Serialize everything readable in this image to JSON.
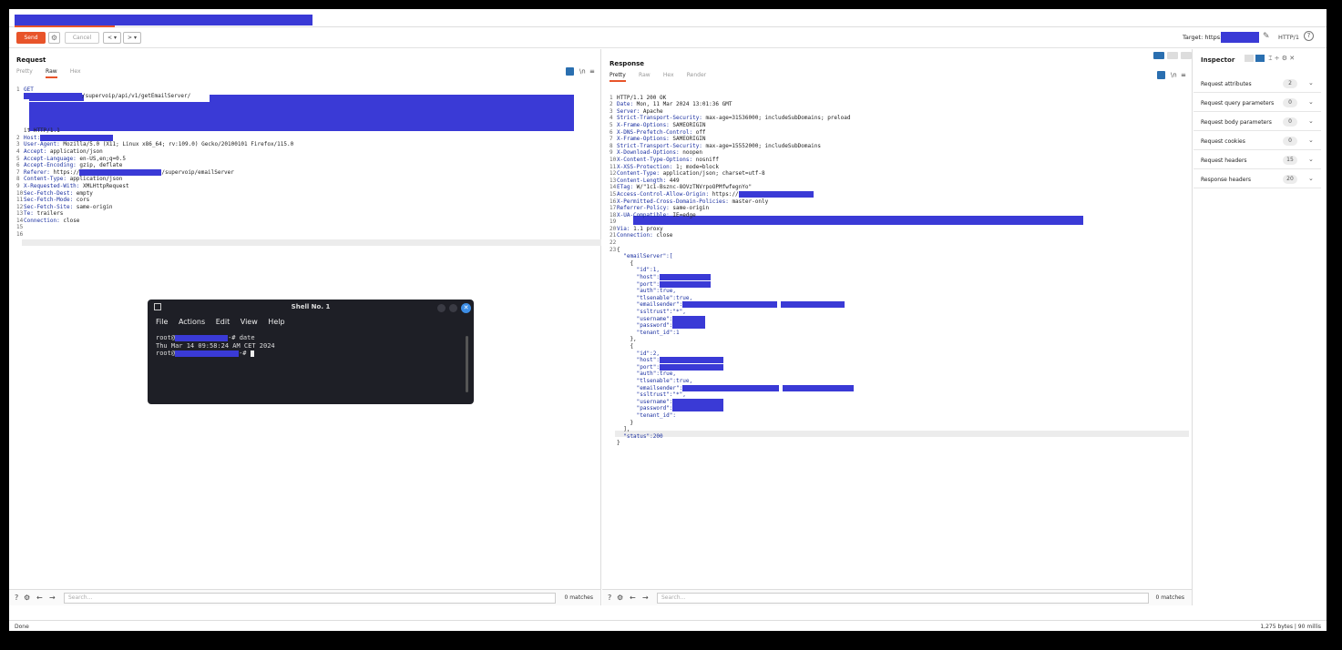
{
  "toolbar": {
    "send_label": "Send",
    "cancel_label": "Cancel",
    "back_label": "< ▾",
    "forward_label": "> ▾",
    "target_label": "Target: https://",
    "protocol_label": "HTTP/1"
  },
  "request": {
    "title": "Request",
    "tabs": [
      "Pretty",
      "Raw",
      "Hex"
    ],
    "active_tab": "Raw",
    "lines": [
      {
        "n": "1",
        "k": "GET",
        "v": ""
      },
      {
        "n": "",
        "k": "",
        "v": "/supervoip/api/v1/getEmailServer/"
      },
      {
        "n": "",
        "k": "",
        "v": "it HTTP/1.1"
      },
      {
        "n": "2",
        "k": "Host:",
        "v": ""
      },
      {
        "n": "3",
        "k": "User-Agent:",
        "v": " Mozilla/5.0 (X11; Linux x86_64; rv:109.0) Gecko/20100101 Firefox/115.0"
      },
      {
        "n": "4",
        "k": "Accept:",
        "v": " application/json"
      },
      {
        "n": "5",
        "k": "Accept-Language:",
        "v": " en-US,en;q=0.5"
      },
      {
        "n": "6",
        "k": "Accept-Encoding:",
        "v": " gzip, deflate"
      },
      {
        "n": "7",
        "k": "Referer:",
        "v": " https://"
      },
      {
        "n": "8",
        "k": "Content-Type:",
        "v": " application/json"
      },
      {
        "n": "9",
        "k": "X-Requested-With:",
        "v": " XMLHttpRequest"
      },
      {
        "n": "10",
        "k": "Sec-Fetch-Dest:",
        "v": " empty"
      },
      {
        "n": "11",
        "k": "Sec-Fetch-Mode:",
        "v": " cors"
      },
      {
        "n": "12",
        "k": "Sec-Fetch-Site:",
        "v": " same-origin"
      },
      {
        "n": "13",
        "k": "Te:",
        "v": " trailers"
      },
      {
        "n": "14",
        "k": "Connection:",
        "v": " close"
      },
      {
        "n": "15",
        "k": "",
        "v": ""
      },
      {
        "n": "16",
        "k": "",
        "v": ""
      }
    ],
    "referer_suffix": "/supervoip/emailServer",
    "search_placeholder": "Search...",
    "matches": "0 matches"
  },
  "response": {
    "title": "Response",
    "tabs": [
      "Pretty",
      "Raw",
      "Hex",
      "Render"
    ],
    "active_tab": "Pretty",
    "lines": [
      {
        "n": "1",
        "k": "HTTP/1.1 200 OK",
        "v": ""
      },
      {
        "n": "2",
        "k": "Date:",
        "v": " Mon, 11 Mar 2024 13:01:36 GMT"
      },
      {
        "n": "3",
        "k": "Server:",
        "v": " Apache"
      },
      {
        "n": "4",
        "k": "Strict-Transport-Security:",
        "v": " max-age=31536000; includeSubDomains; preload"
      },
      {
        "n": "5",
        "k": "X-Frame-Options:",
        "v": " SAMEORIGIN"
      },
      {
        "n": "6",
        "k": "X-DNS-Prefetch-Control:",
        "v": " off"
      },
      {
        "n": "7",
        "k": "X-Frame-Options:",
        "v": " SAMEORIGIN"
      },
      {
        "n": "8",
        "k": "Strict-Transport-Security:",
        "v": " max-age=15552000; includeSubDomains"
      },
      {
        "n": "9",
        "k": "X-Download-Options:",
        "v": " noopen"
      },
      {
        "n": "10",
        "k": "X-Content-Type-Options:",
        "v": " nosniff"
      },
      {
        "n": "11",
        "k": "X-XSS-Protection:",
        "v": " 1; mode=block"
      },
      {
        "n": "12",
        "k": "Content-Type:",
        "v": " application/json; charset=utf-8"
      },
      {
        "n": "13",
        "k": "Content-Length:",
        "v": " 449"
      },
      {
        "n": "14",
        "k": "ETag:",
        "v": " W/\"1c1-Bsznc-8OVzTNVrpoOPMfwfegnYo\""
      },
      {
        "n": "15",
        "k": "Access-Control-Allow-Origin:",
        "v": " https://"
      },
      {
        "n": "16",
        "k": "X-Permitted-Cross-Domain-Policies:",
        "v": " master-only"
      },
      {
        "n": "17",
        "k": "Referrer-Policy:",
        "v": " same-origin"
      },
      {
        "n": "18",
        "k": "X-UA-Compatible:",
        "v": " IE=edge"
      },
      {
        "n": "19",
        "k": "",
        "v": ""
      },
      {
        "n": "20",
        "k": "Via:",
        "v": " 1.1 proxy"
      },
      {
        "n": "21",
        "k": "Connection:",
        "v": " close"
      },
      {
        "n": "22",
        "k": "",
        "v": ""
      },
      {
        "n": "23",
        "k": "{",
        "v": ""
      }
    ],
    "json_lines": [
      "  \"emailServer\":[",
      "    {",
      "      \"id\":1,",
      "      \"host\":",
      "      \"port\":",
      "      \"auth\":true,",
      "      \"tlsenable\":true,",
      "      \"emailsender\":",
      "      \"ssltrust\":\"*\",",
      "      \"username\":",
      "      \"password\":",
      "      \"tenant_id\":1",
      "    },",
      "    {",
      "      \"id\":2,",
      "      \"host\":",
      "      \"port\":",
      "      \"auth\":true,",
      "      \"tlsenable\":true,",
      "      \"emailsender\":",
      "      \"ssltrust\":\"*\",",
      "      \"username\":",
      "      \"password\":",
      "      \"tenant_id\":",
      "    }",
      "  ],",
      "  \"status\":200",
      "}"
    ],
    "search_placeholder": "Search...",
    "matches": "0 matches"
  },
  "inspector": {
    "title": "Inspector",
    "rows": [
      {
        "label": "Request attributes",
        "count": "2"
      },
      {
        "label": "Request query parameters",
        "count": "0"
      },
      {
        "label": "Request body parameters",
        "count": "0"
      },
      {
        "label": "Request cookies",
        "count": "0"
      },
      {
        "label": "Request headers",
        "count": "15"
      },
      {
        "label": "Response headers",
        "count": "20"
      }
    ]
  },
  "terminal": {
    "title": "Shell No. 1",
    "menu": [
      "File",
      "Actions",
      "Edit",
      "View",
      "Help"
    ],
    "line1_prefix": "root@",
    "line1_suffix": "-# date",
    "line2": "Thu Mar 14 09:58:24 AM CET 2024",
    "line3_prefix": "root@",
    "line3_suffix": "-#"
  },
  "status": {
    "left": "Done",
    "right": "1,275 bytes | 90 millis"
  },
  "colors": {
    "accent": "#e8542a",
    "redaction": "#3a3ad6",
    "key": "#1a2fa0",
    "terminal_bg": "#1e1f26"
  }
}
